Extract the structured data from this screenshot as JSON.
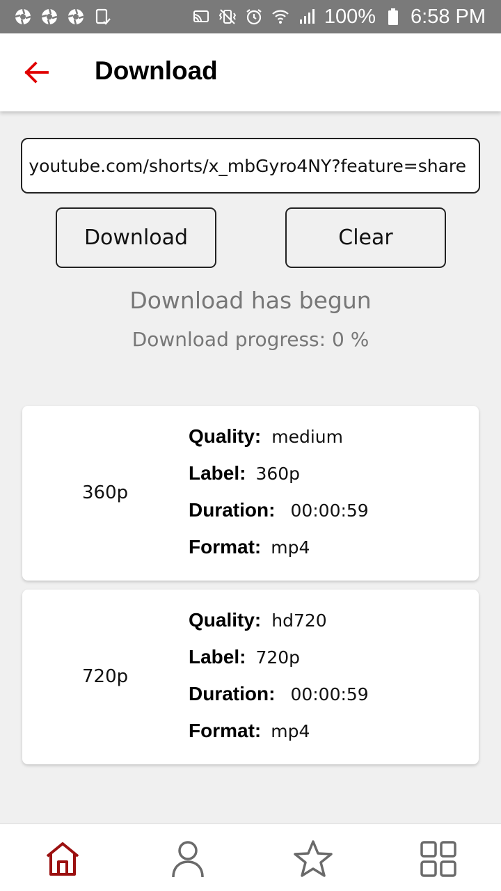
{
  "status_bar": {
    "battery": "100%",
    "time": "6:58 PM",
    "left_icons": [
      "aperture-icon",
      "aperture-icon",
      "aperture-icon",
      "tablet-check-icon"
    ],
    "right_icons": [
      "cast-icon",
      "vibrate-icon",
      "alarm-icon",
      "wifi-icon",
      "signal-icon",
      "battery-icon"
    ]
  },
  "app_bar": {
    "title": "Download",
    "back_icon": "arrow-left-icon",
    "accent": "#e00000"
  },
  "url_input": {
    "value": "youtube.com/shorts/x_mbGyro4NY?feature=share"
  },
  "buttons": {
    "download": "Download",
    "clear": "Clear"
  },
  "status": {
    "message": "Download has begun",
    "progress": "Download progress: 0 %"
  },
  "videos": [
    {
      "resolution": "360p",
      "quality_key": "Quality:",
      "quality": "medium",
      "label_key": "Label:",
      "label": "360p",
      "duration_key": "Duration:",
      "duration": "00:00:59",
      "format_key": "Format:",
      "format": "mp4"
    },
    {
      "resolution": "720p",
      "quality_key": "Quality:",
      "quality": "hd720",
      "label_key": "Label:",
      "label": "720p",
      "duration_key": "Duration:",
      "duration": "00:00:59",
      "format_key": "Format:",
      "format": "mp4"
    }
  ],
  "bottom_nav": {
    "items": [
      "home-icon",
      "profile-icon",
      "star-icon",
      "grid-icon"
    ],
    "active": "home-icon",
    "active_color": "#9b1010",
    "inactive_color": "#6a6a6a"
  }
}
